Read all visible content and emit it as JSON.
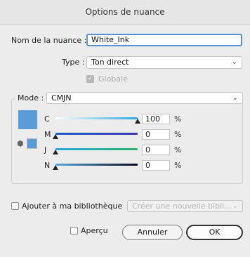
{
  "window": {
    "title": "Options de nuance"
  },
  "form": {
    "name_label": "Nom de la nuance :",
    "name_value": "White_Ink",
    "type_label": "Type :",
    "type_value": "Ton direct",
    "global_label": "Globale",
    "global_checked": true
  },
  "mode": {
    "label": "Mode :",
    "value": "CMJN",
    "swatch_color": "#5b9bd8"
  },
  "channels": [
    {
      "label": "C",
      "value": "100",
      "unit": "%",
      "level": 1.0,
      "gradient": [
        "#ffffff",
        "#2aa9e0"
      ]
    },
    {
      "label": "M",
      "value": "0",
      "unit": "%",
      "level": 0.0,
      "gradient": [
        "#1e5fc4",
        "#3a3ab0"
      ]
    },
    {
      "label": "J",
      "value": "0",
      "unit": "%",
      "level": 0.0,
      "gradient": [
        "#2aa9e0",
        "#2fb36a"
      ]
    },
    {
      "label": "N",
      "value": "0",
      "unit": "%",
      "level": 0.0,
      "gradient": [
        "#5aa9e0",
        "#0b0b1a"
      ]
    }
  ],
  "library": {
    "checkbox_label": "Ajouter à ma bibliothèque",
    "select_placeholder": "Créer une nouvelle bibli..."
  },
  "footer": {
    "preview_label": "Aperçu",
    "cancel_label": "Annuler",
    "ok_label": "OK"
  },
  "colors": {
    "focus": "#5b93d8",
    "swatch": "#5b9bd8"
  }
}
